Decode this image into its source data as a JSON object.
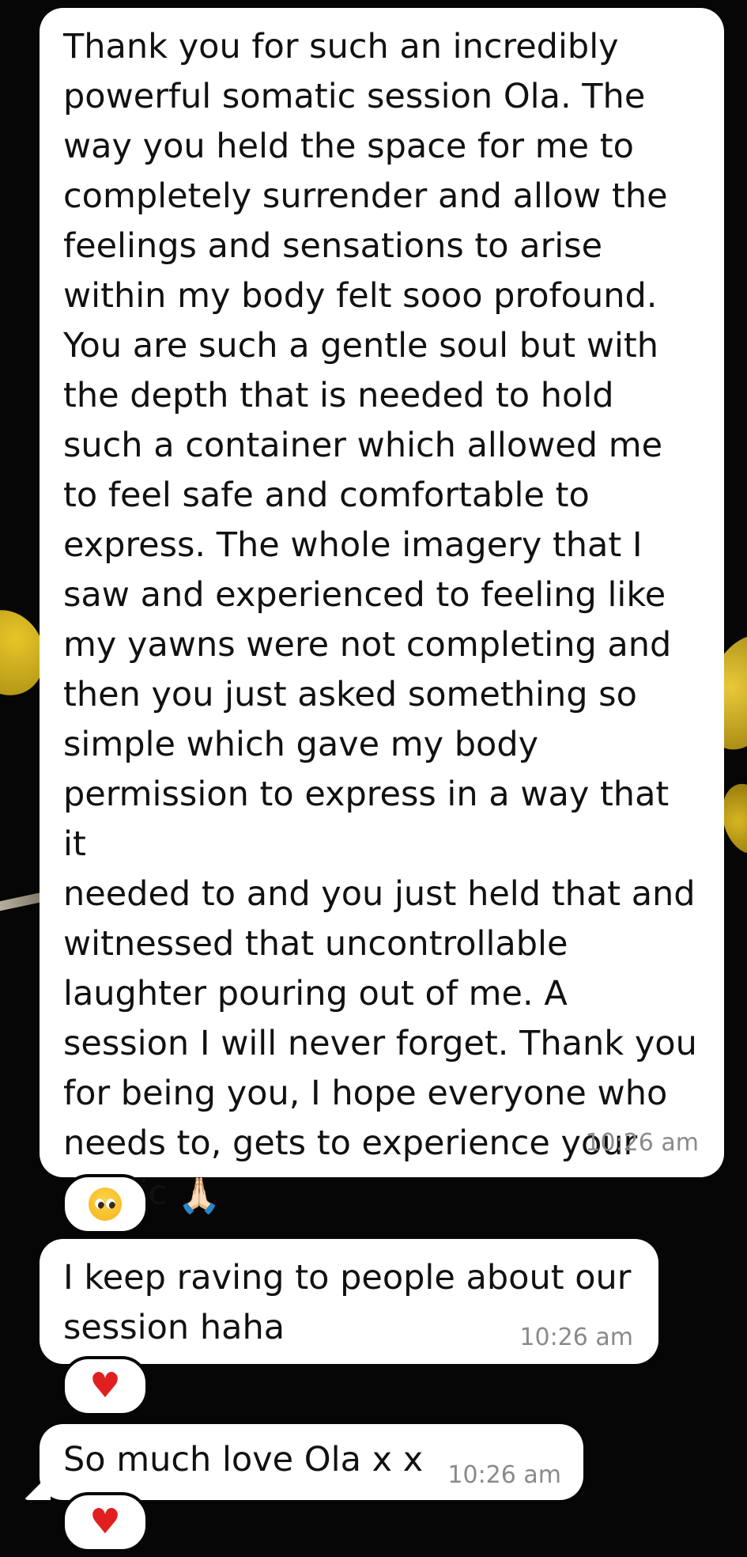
{
  "messages": [
    {
      "text": "Thank you for such an incredibly\npowerful somatic session Ola. The\nway you held the space for me to\ncompletely surrender and allow the\nfeelings and sensations to arise\nwithin my body felt sooo profound.\nYou are such a gentle soul but with\nthe depth that is needed to hold\nsuch a container which allowed me\nto feel safe and comfortable to\nexpress. The whole imagery that I\nsaw and experienced to feeling like\nmy yawns were not completing and\nthen you just asked something so\nsimple which gave my body\npermission to express in a way that it\nneeded to and you just held that and\nwitnessed that uncontrollable\nlaughter pouring out of me. A\nsession I will never forget. Thank you\nfor being you, I hope everyone who\nneeds to, gets to experience your\nmagic",
      "emoji": "🙏🏻",
      "emoji_icon": "folded-hands-icon",
      "time": "10:26 am",
      "reaction": "🥺",
      "reaction_icon": "pleading-face-icon"
    },
    {
      "text": "I keep raving to people about our\nsession haha",
      "time": "10:26 am",
      "reaction": "❤️",
      "reaction_icon": "red-heart-icon"
    },
    {
      "text": "So much love Ola x x",
      "time": "10:26 am",
      "reaction": "❤️",
      "reaction_icon": "red-heart-icon"
    }
  ],
  "colors": {
    "background": "#060606",
    "bubble": "#ffffff",
    "text": "#111111",
    "timestamp": "#8a8a8a",
    "heart": "#e0201f"
  }
}
